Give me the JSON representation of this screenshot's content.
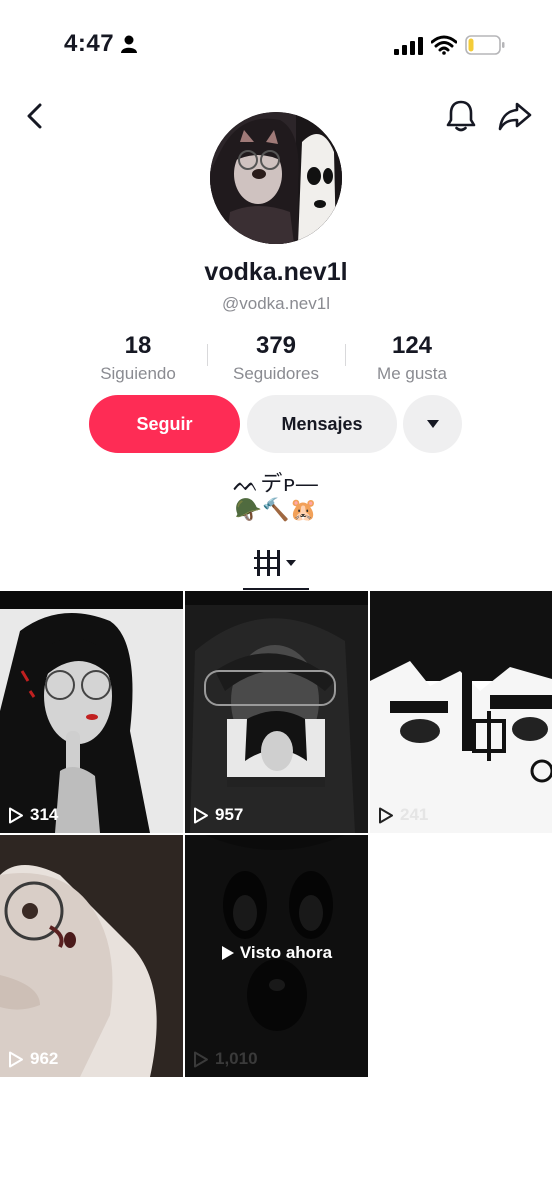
{
  "status_bar": {
    "time": "4:47"
  },
  "header": {
    "back_icon": "chevron-left-icon",
    "bell_icon": "bell-icon",
    "share_icon": "share-icon"
  },
  "profile": {
    "username": "vodka.nev1l",
    "handle": "@vodka.nev1l",
    "stats": [
      {
        "value": "18",
        "label": "Siguiendo"
      },
      {
        "value": "379",
        "label": "Seguidores"
      },
      {
        "value": "124",
        "label": "Me gusta"
      }
    ],
    "follow_label": "Seguir",
    "message_label": "Mensajes",
    "bio_line1": "ᨓデᴘ—",
    "bio_line2": "🪖🔨🐹"
  },
  "videos": [
    {
      "views": "314"
    },
    {
      "views": "957"
    },
    {
      "views": "241"
    },
    {
      "views": "962"
    },
    {
      "views": "1,010",
      "watched_label": "Visto ahora"
    }
  ],
  "colors": {
    "accent": "#fe2c55",
    "secondary_button": "#efeff0",
    "muted_text": "#8a8b91"
  }
}
